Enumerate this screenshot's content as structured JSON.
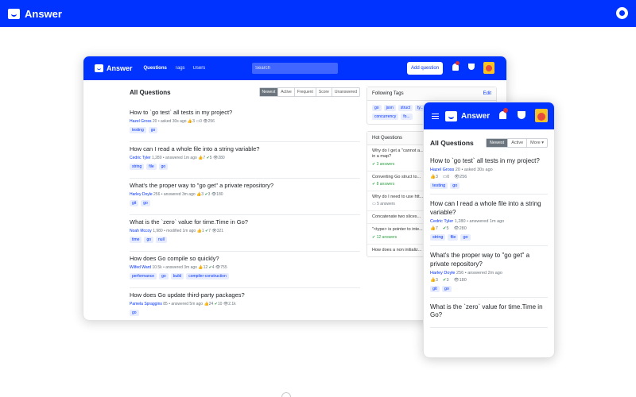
{
  "site": {
    "title": "Answer"
  },
  "desktop": {
    "brand": "Answer",
    "nav": [
      "Questions",
      "Tags",
      "Users"
    ],
    "search_placeholder": "Search",
    "add_button": "Add question",
    "heading": "All Questions",
    "tabs": [
      "Newest",
      "Active",
      "Frequent",
      "Score",
      "Unanswered"
    ],
    "questions": [
      {
        "title": "How to `go test` all tests in my project?",
        "user": "Hazel Gross",
        "rep": "20",
        "action": "• asked 30s ago",
        "votes": "3",
        "answers": "0",
        "views": "256",
        "tags": [
          "testing",
          "go"
        ]
      },
      {
        "title": "How can I read a whole file into a string variable?",
        "user": "Cedric Tyler",
        "rep": "1,280",
        "action": "• answered 1m ago",
        "votes": "7",
        "answers": "5",
        "views": "280",
        "tags": [
          "string",
          "file",
          "go"
        ]
      },
      {
        "title": "What's the proper way to \"go get\" a private repository?",
        "user": "Harley Doyle",
        "rep": "256",
        "action": "• answered 3m ago",
        "votes": "3",
        "answers": "3",
        "views": "180",
        "tags": [
          "git",
          "go"
        ]
      },
      {
        "title": "What is the `zero` value for time.Time in Go?",
        "user": "Noah Mccoy",
        "rep": "1,980",
        "action": "• modified 1m ago",
        "votes": "1",
        "answers": "7",
        "views": "321",
        "tags": [
          "time",
          "go",
          "null"
        ]
      },
      {
        "title": "How does Go compile so quickly?",
        "user": "Wilfed Ward",
        "rep": "10.5k",
        "action": "• answered 3m ago",
        "votes": "12",
        "answers": "4",
        "views": "755",
        "tags": [
          "performance",
          "go",
          "build",
          "compiler-construction"
        ]
      },
      {
        "title": "How does Go update third-party packages?",
        "user": "Pamela Spraggins",
        "rep": "85",
        "action": "• answered 5m ago",
        "votes": "24",
        "answers": "10",
        "views": "2.1k",
        "tags": [
          "go"
        ]
      }
    ],
    "following_tags": {
      "title": "Following Tags",
      "edit": "Edit",
      "tags": [
        "go",
        "json",
        "struct",
        "ty...",
        "mongodb",
        "goroutine",
        "slice",
        "concurrency",
        "fo..."
      ]
    },
    "hot_questions": {
      "title": "Hot Questions",
      "items": [
        {
          "text": "Why do I get a \"cannot a... when setting value to a s... value in a map?",
          "answers": "3 answers",
          "accepted": true
        },
        {
          "text": "Converting Go struct to...",
          "answers": "8 answers",
          "accepted": true
        },
        {
          "text": "Why do I need to use htt... to access my static files...",
          "answers": "5 answers",
          "accepted": false
        },
        {
          "text": "Concatenate two slices...",
          "answers": "",
          "accepted": false
        },
        {
          "text": "\"<type> is pointer to inte... interface\" confusion",
          "answers": "12 answers",
          "accepted": true
        },
        {
          "text": "How does a non initializ... behave?",
          "answers": "",
          "accepted": false
        }
      ]
    }
  },
  "mobile": {
    "brand": "Answer",
    "heading": "All Questions",
    "tabs": [
      "Newest",
      "Active",
      "More ▾"
    ],
    "questions": [
      {
        "title": "How to `go test` all tests in my project?",
        "user": "Hazel Gross",
        "rep": "20",
        "action": "• asked 30s ago",
        "votes": "3",
        "answers": "0",
        "views": "256",
        "tags": [
          "testing",
          "go"
        ]
      },
      {
        "title": "How can I read a whole file into a string variable?",
        "user": "Cedric Tyler",
        "rep": "1,280",
        "action": "• answered 1m ago",
        "votes": "7",
        "answers": "5",
        "views": "280",
        "tags": [
          "string",
          "file",
          "go"
        ]
      },
      {
        "title": "What's the proper way to \"go get\" a private repository?",
        "user": "Harley Doyle",
        "rep": "256",
        "action": "• answered 2m ago",
        "votes": "3",
        "answers": "3",
        "views": "180",
        "tags": [
          "git",
          "go"
        ]
      },
      {
        "title": "What is the `zero` value for time.Time in Go?",
        "user": "",
        "rep": "",
        "action": "",
        "votes": "",
        "answers": "",
        "views": "",
        "tags": []
      }
    ]
  },
  "colors": {
    "brand": "#0033ff",
    "tag_bg": "#e7edff",
    "accepted": "#2f9e44",
    "notify": "#e03131"
  }
}
